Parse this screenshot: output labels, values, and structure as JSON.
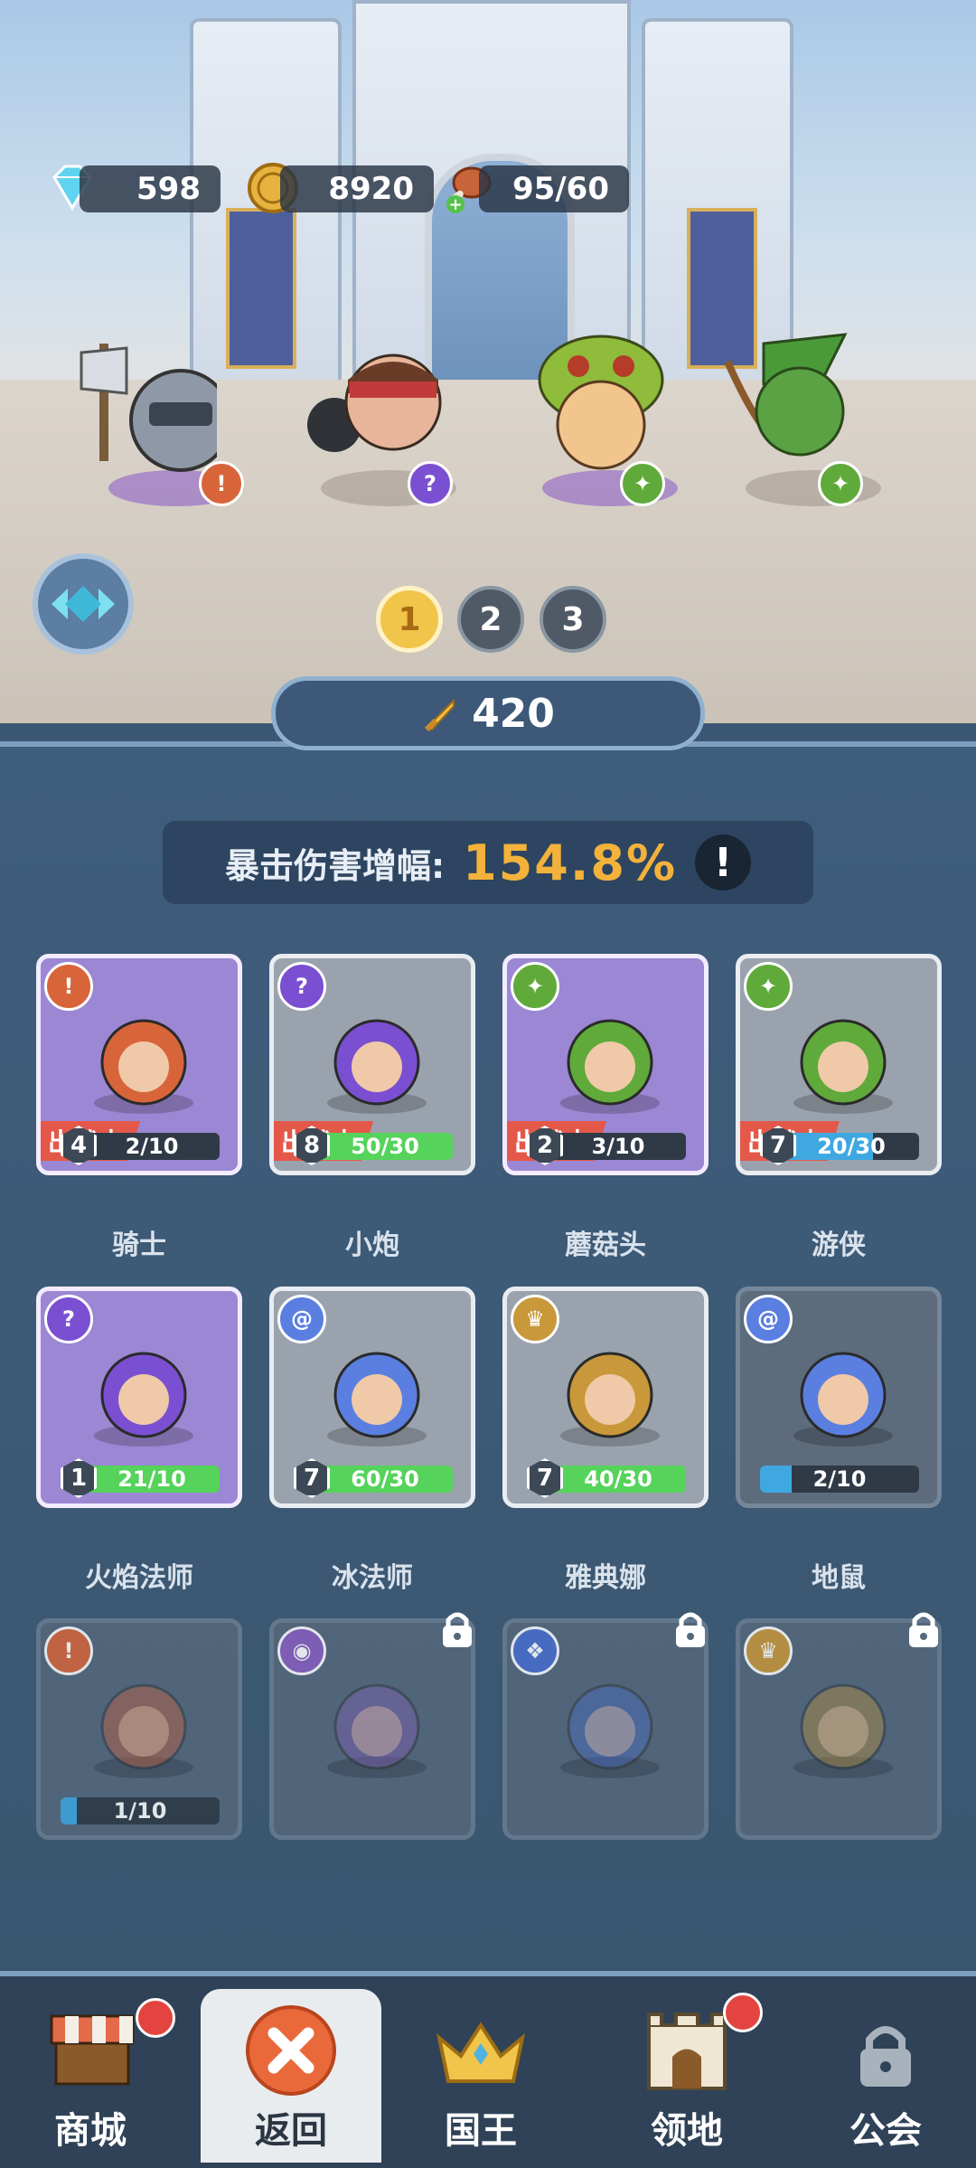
{
  "resources": {
    "gems": "598",
    "gold": "8920",
    "stamina": "95/60"
  },
  "team_tabs": [
    "1",
    "2",
    "3"
  ],
  "active_team": "1",
  "team_power": "420",
  "stat": {
    "label": "暴击伤害增幅:",
    "value": "154.8%",
    "info": "!"
  },
  "deploy_label": "出战中",
  "heroes": [
    {
      "name": "骑士",
      "level": "4",
      "progress": "2/10",
      "deployed": true,
      "role": "warrior",
      "frame": "purple",
      "fill_pct": 0,
      "bar_color": "#7d8a98"
    },
    {
      "name": "小炮",
      "level": "8",
      "progress": "50/30",
      "deployed": true,
      "role": "mage",
      "frame": "gray",
      "fill_pct": 100,
      "bar_color": "#55d35a"
    },
    {
      "name": "蘑菇头",
      "level": "2",
      "progress": "3/10",
      "deployed": true,
      "role": "ranger",
      "frame": "purple",
      "fill_pct": 0,
      "bar_color": "#7d8a98"
    },
    {
      "name": "游侠",
      "level": "7",
      "progress": "20/30",
      "deployed": true,
      "role": "ranger",
      "frame": "gray",
      "fill_pct": 66,
      "bar_color": "#3fa8e0"
    },
    {
      "name": "火焰法师",
      "level": "1",
      "progress": "21/10",
      "deployed": false,
      "role": "mage",
      "frame": "purple",
      "fill_pct": 100,
      "bar_color": "#55d35a"
    },
    {
      "name": "冰法师",
      "level": "7",
      "progress": "60/30",
      "deployed": false,
      "role": "spiral",
      "frame": "gray",
      "fill_pct": 100,
      "bar_color": "#55d35a"
    },
    {
      "name": "雅典娜",
      "level": "7",
      "progress": "40/30",
      "deployed": false,
      "role": "crown",
      "frame": "gray",
      "fill_pct": 100,
      "bar_color": "#55d35a"
    },
    {
      "name": "地鼠",
      "level": "",
      "progress": "2/10",
      "deployed": false,
      "role": "spiral",
      "frame": "dim",
      "fill_pct": 20,
      "bar_color": "#3fa8e0"
    },
    {
      "name": "",
      "level": "",
      "progress": "1/10",
      "deployed": false,
      "role": "warrior",
      "frame": "locked",
      "fill_pct": 10,
      "bar_color": "#3fa8e0"
    },
    {
      "name": "",
      "level": "",
      "progress": "",
      "deployed": false,
      "role": "eye",
      "frame": "locked",
      "fill_pct": 0,
      "bar_color": "#3fa8e0"
    },
    {
      "name": "",
      "level": "",
      "progress": "",
      "deployed": false,
      "role": "paw",
      "frame": "locked",
      "fill_pct": 0,
      "bar_color": "#3fa8e0"
    },
    {
      "name": "",
      "level": "",
      "progress": "",
      "deployed": false,
      "role": "crown",
      "frame": "locked",
      "fill_pct": 0,
      "bar_color": "#3fa8e0"
    }
  ],
  "nav": {
    "shop": "商城",
    "back": "返回",
    "king": "国王",
    "territory": "领地",
    "guild": "公会"
  },
  "colors": {
    "warrior": "#d8653a",
    "mage": "#7b4fd1",
    "ranger": "#5faa3a",
    "spiral": "#5a7fe0",
    "crown": "#c8983a",
    "eye": "#8a5fc0",
    "paw": "#4b6fd0"
  }
}
